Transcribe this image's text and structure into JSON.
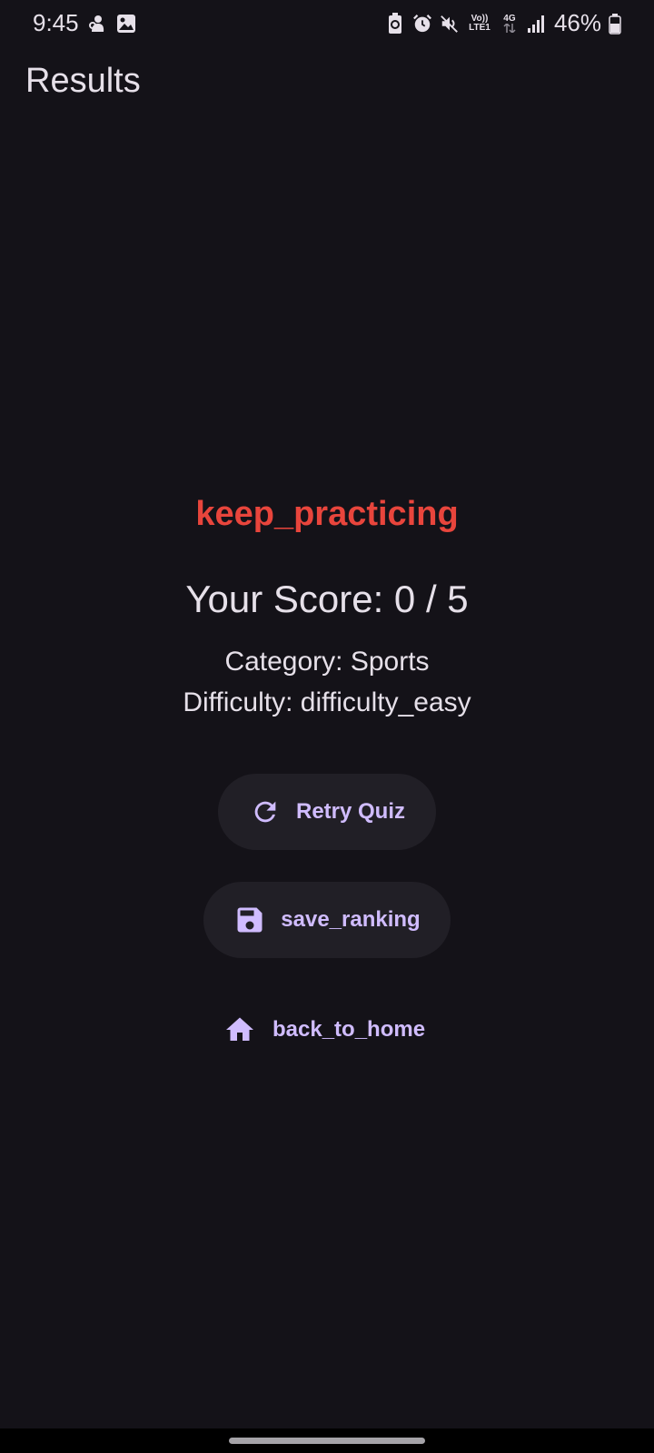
{
  "status_bar": {
    "time": "9:45",
    "battery_percent": "46%",
    "net_top": "Vo))",
    "net_bottom": "LTE1",
    "net_type": "4G",
    "icons": [
      "notification-icon",
      "image-icon",
      "battery-saver-icon",
      "alarm-icon",
      "mute-icon",
      "signal-icon",
      "battery-icon"
    ]
  },
  "app_bar": {
    "title": "Results"
  },
  "result": {
    "headline": "keep_practicing",
    "headline_color": "#e8453c",
    "score_text": "Your Score: 0 / 5",
    "category_text": "Category: Sports",
    "difficulty_text": "Difficulty: difficulty_easy"
  },
  "actions": {
    "retry_label": "Retry Quiz",
    "save_label": "save_ranking",
    "home_label": "back_to_home",
    "accent_color": "#d0bcff"
  }
}
